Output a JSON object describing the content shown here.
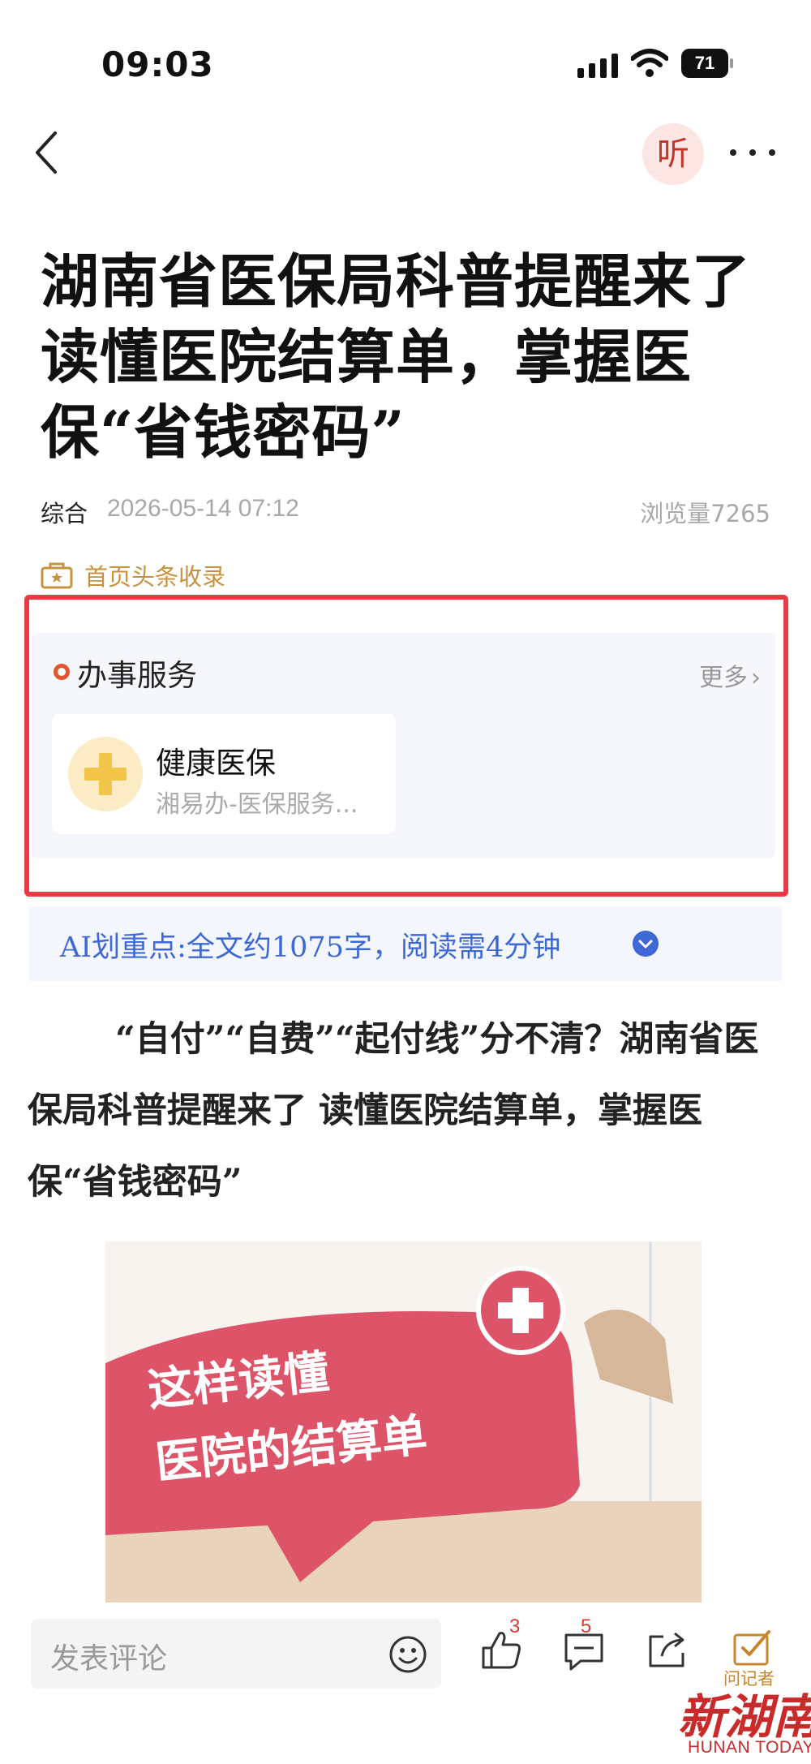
{
  "status_bar": {
    "time": "09:03",
    "battery": "71"
  },
  "nav": {
    "listen_label": "听"
  },
  "article": {
    "title": "湖南省医保局科普提醒来了 读懂医院结算单，掌握医保“省钱密码”",
    "category": "综合",
    "date": "2026-05-14 07:12",
    "views": "浏览量7265",
    "featured_label": "首页头条收录",
    "body": "“自付”“自费”“起付线”分不清？湖南省医保局科普提醒来了  读懂医院结算单，掌握医保“省钱密码”"
  },
  "service": {
    "title": "办事服务",
    "more_label": "更多",
    "item": {
      "name": "健康医保",
      "desc": "湘易办-医保服务..."
    }
  },
  "ai_summary": {
    "text": "AI划重点:全文约1075字，阅读需4分钟"
  },
  "illustration": {
    "banner_line1": "这样读懂",
    "banner_line2": "医院的结算单"
  },
  "toolbar": {
    "comment_placeholder": "发表评论",
    "like_count": "3",
    "comment_count": "5",
    "ask_label": "问记者"
  },
  "watermark": {
    "logo_text": "新湖南",
    "subtitle": "HUNAN TODAY"
  },
  "colors": {
    "accent_red": "#ea3a45",
    "ai_blue": "#3d68d6",
    "featured_gold": "#c8913d"
  }
}
